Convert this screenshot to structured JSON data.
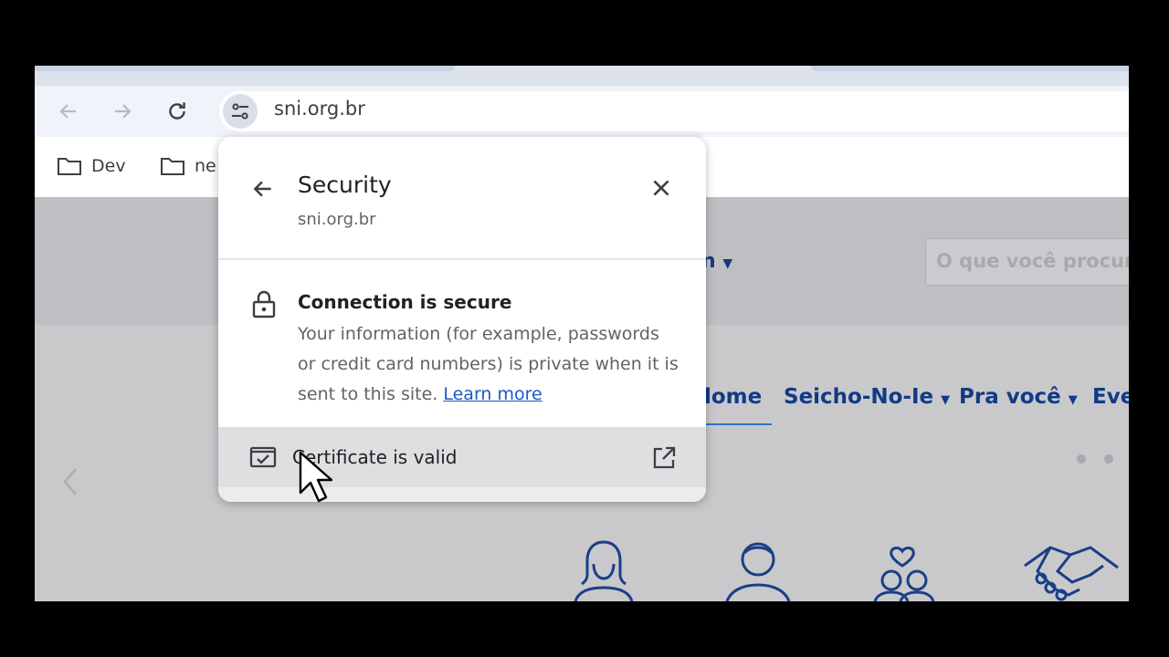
{
  "toolbar": {
    "url": "sni.org.br"
  },
  "bookmarks": [
    {
      "label": "Dev"
    },
    {
      "label": "ne"
    }
  ],
  "page": {
    "search_placeholder": "O que você procur",
    "header_menu_partial": "n",
    "nav": [
      {
        "label": "lome",
        "active": true
      },
      {
        "label": "Seicho-No-Ie"
      },
      {
        "label": "Pra você"
      },
      {
        "label": "Eve"
      }
    ]
  },
  "popup": {
    "title": "Security",
    "site": "sni.org.br",
    "connection_title": "Connection is secure",
    "connection_desc": "Your information (for example, passwords or credit card numbers) is private when it is sent to this site.",
    "learn_more": "Learn more",
    "certificate": "Certificate is valid"
  },
  "colors": {
    "accent": "#1a58c8",
    "nav_text": "#123a86",
    "toolbar_bg": "#f0f3fa"
  }
}
